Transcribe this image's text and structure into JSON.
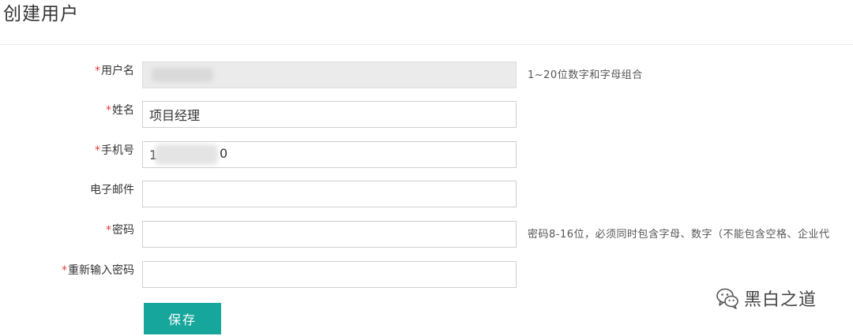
{
  "page": {
    "title": "创建用户"
  },
  "form": {
    "required_mark": "*",
    "fields": [
      {
        "label": "用户名",
        "required": true,
        "value": "",
        "hint": "1~20位数字和字母组合",
        "disabled": true
      },
      {
        "label": "姓名",
        "required": true,
        "value": "项目经理",
        "hint": "",
        "disabled": false
      },
      {
        "label": "手机号",
        "required": true,
        "value": "1",
        "value_end": "0",
        "hint": "",
        "disabled": false
      },
      {
        "label": "电子邮件",
        "required": false,
        "value": "",
        "hint": "",
        "disabled": false
      },
      {
        "label": "密码",
        "required": true,
        "value": "",
        "hint": "密码8-16位，必须同时包含字母、数字（不能包含空格、企业代",
        "disabled": false
      },
      {
        "label": "重新输入密码",
        "required": true,
        "value": "",
        "hint": "",
        "disabled": false
      }
    ],
    "save_label": "保存"
  },
  "watermark": {
    "text": "黑白之道",
    "icon": "wechat-icon"
  },
  "colors": {
    "accent": "#17a69c",
    "required": "#e4393c",
    "disabled_bg": "#ebebeb"
  }
}
